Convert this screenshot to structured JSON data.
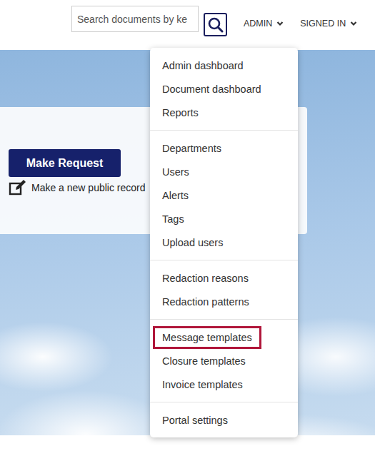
{
  "header": {
    "search": {
      "placeholder": "Search documents by ke"
    },
    "nav": [
      {
        "label": "ADMIN",
        "expanded": true
      },
      {
        "label": "SIGNED IN",
        "expanded": false
      }
    ]
  },
  "card": {
    "button": "Make Request",
    "link": "Make a new public record"
  },
  "menu": {
    "groups": [
      {
        "items": [
          {
            "label": "Admin dashboard",
            "selected": false
          },
          {
            "label": "Document dashboard",
            "selected": false
          },
          {
            "label": "Reports",
            "selected": false
          }
        ]
      },
      {
        "items": [
          {
            "label": "Departments",
            "selected": false
          },
          {
            "label": "Users",
            "selected": false
          },
          {
            "label": "Alerts",
            "selected": false
          },
          {
            "label": "Tags",
            "selected": false
          },
          {
            "label": "Upload users",
            "selected": false
          }
        ]
      },
      {
        "items": [
          {
            "label": "Redaction reasons",
            "selected": false
          },
          {
            "label": "Redaction patterns",
            "selected": false
          }
        ]
      },
      {
        "items": [
          {
            "label": "Message templates",
            "selected": true
          },
          {
            "label": "Closure templates",
            "selected": false
          },
          {
            "label": "Invoice templates",
            "selected": false
          }
        ]
      },
      {
        "items": [
          {
            "label": "Portal settings",
            "selected": false
          }
        ]
      }
    ]
  }
}
